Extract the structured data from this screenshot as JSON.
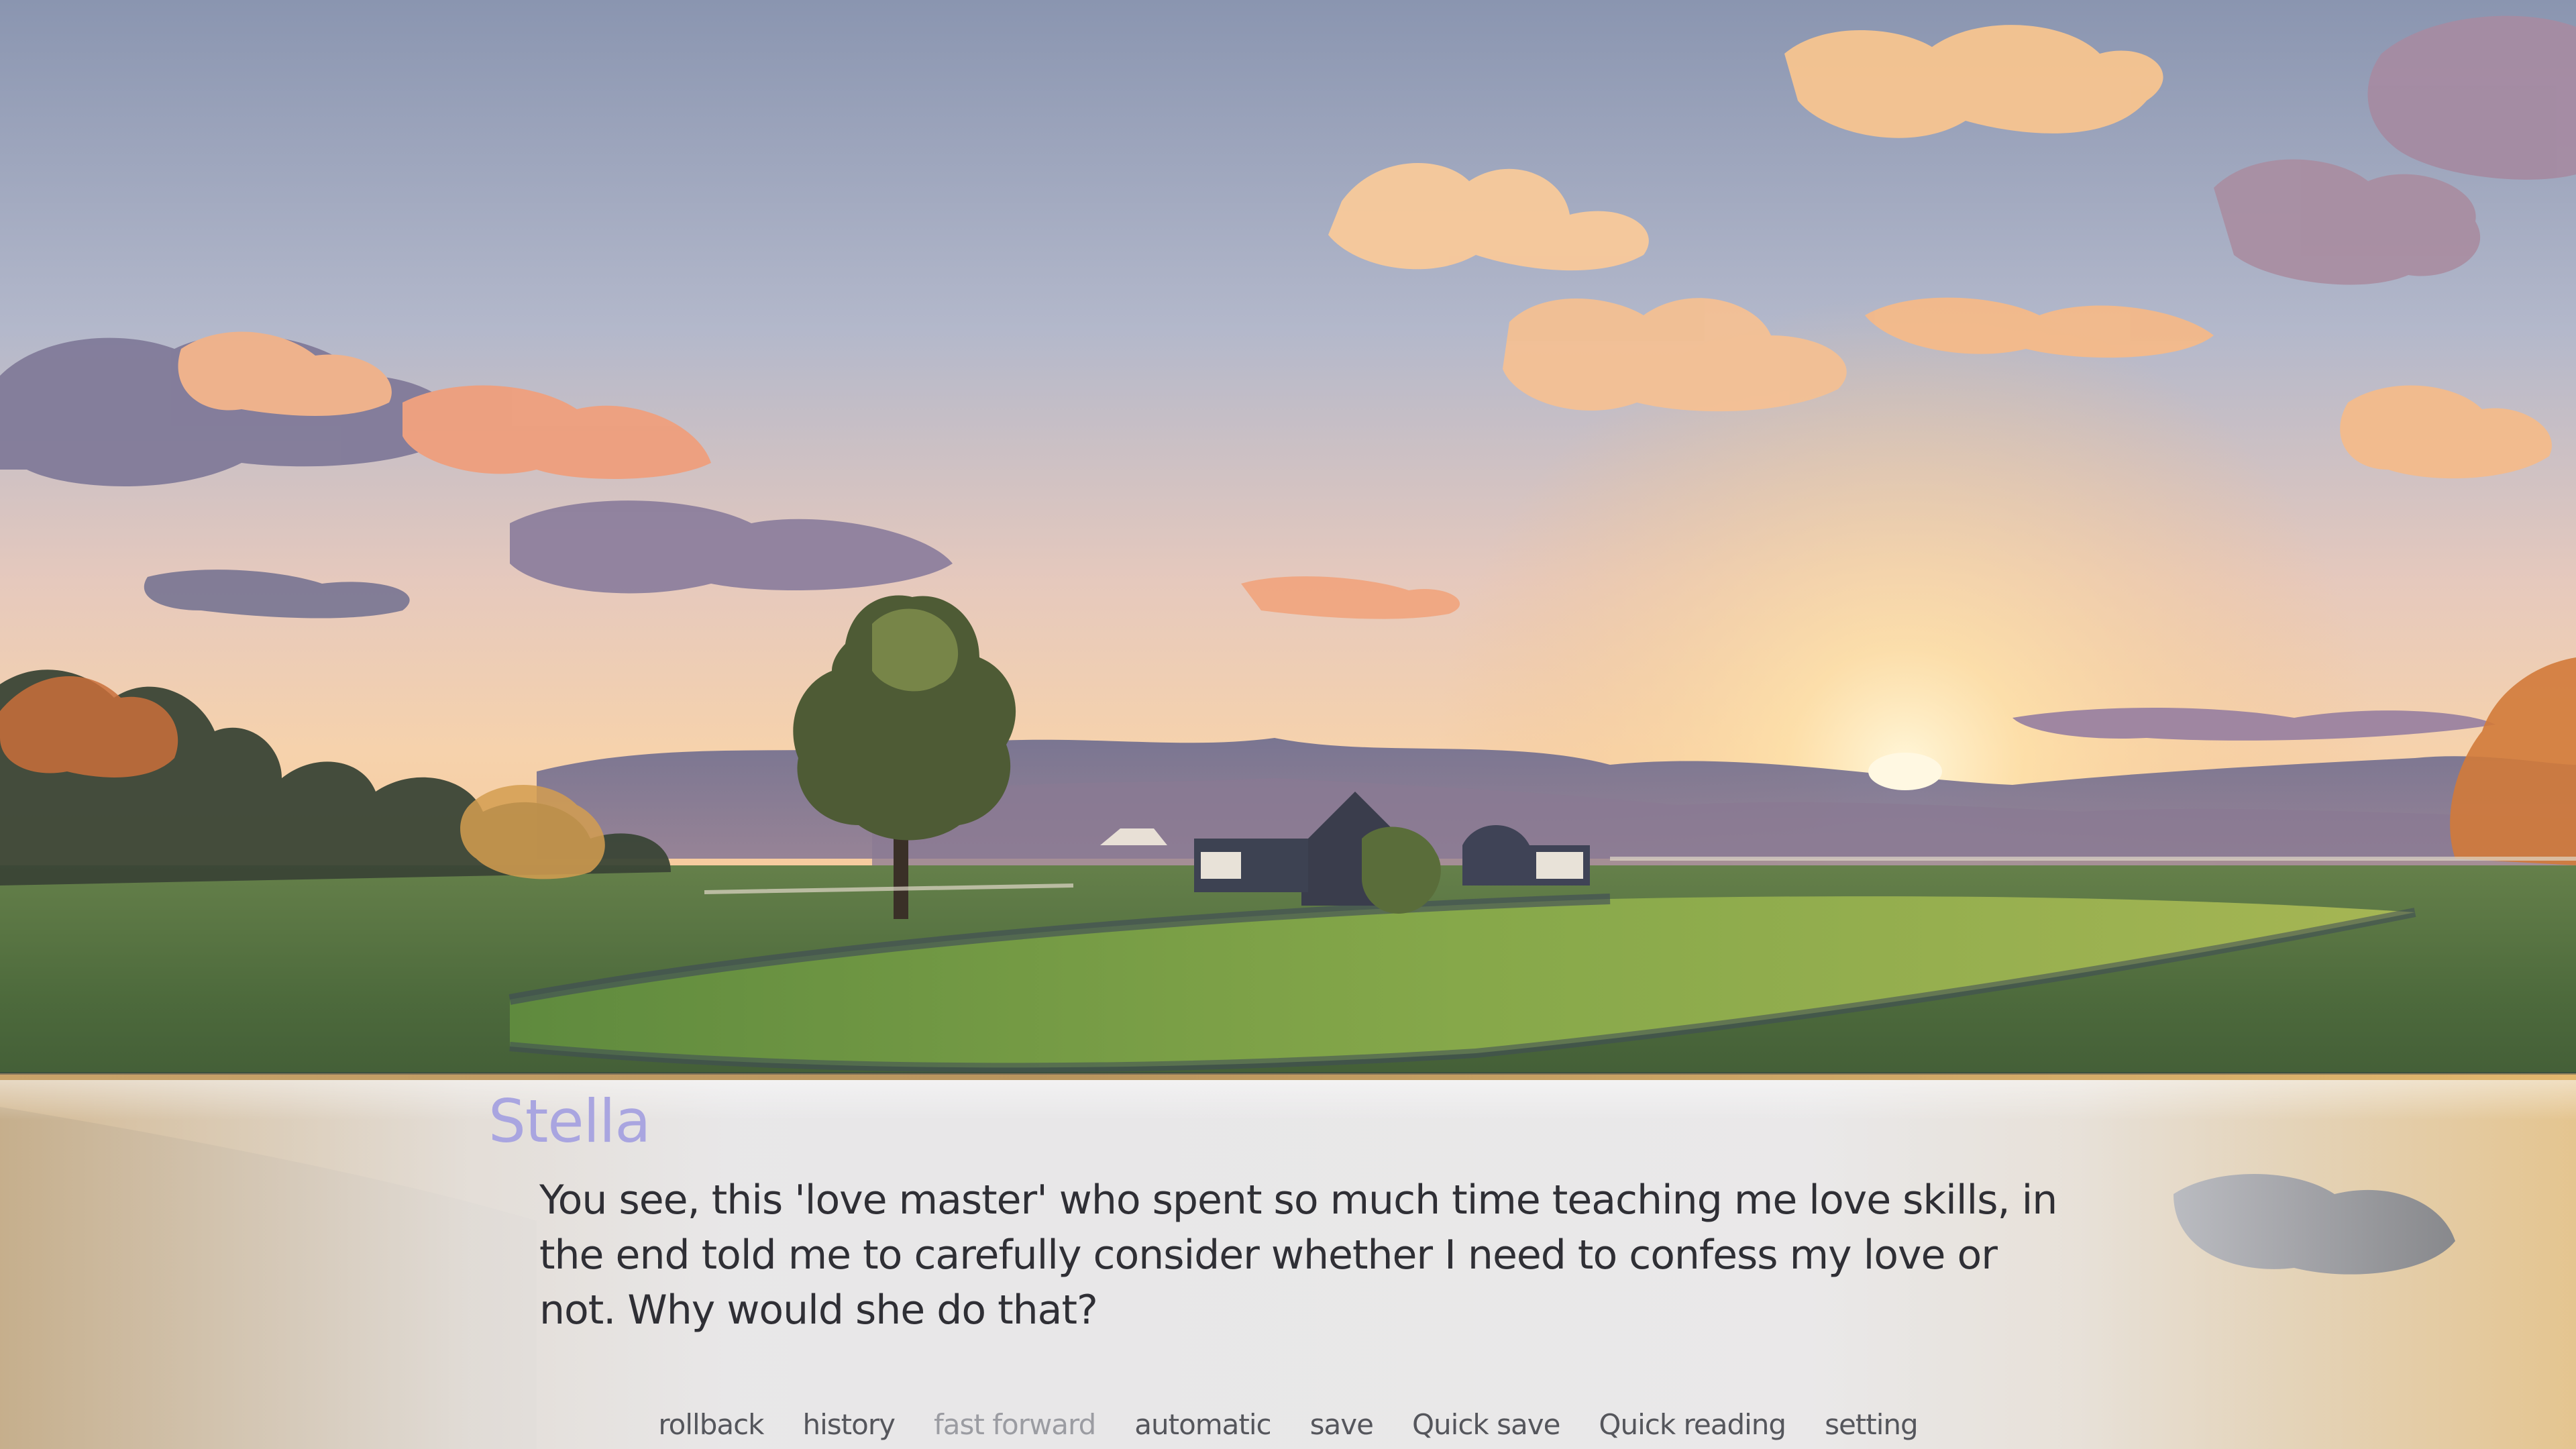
{
  "dialogue": {
    "speaker": "Stella",
    "text": "You see, this 'love master' who spent so much time teaching me love skills, in the end told me to carefully consider whether I need to confess my love or not. Why would she do that?"
  },
  "quick_menu": {
    "items": [
      {
        "label": "rollback",
        "enabled": true
      },
      {
        "label": "history",
        "enabled": true
      },
      {
        "label": "fast forward",
        "enabled": false
      },
      {
        "label": "automatic",
        "enabled": true
      },
      {
        "label": "save",
        "enabled": true
      },
      {
        "label": "Quick save",
        "enabled": true
      },
      {
        "label": "Quick reading",
        "enabled": true
      },
      {
        "label": "setting",
        "enabled": true
      }
    ]
  },
  "colors": {
    "speaker_name": "#a9a5e0",
    "dialogue_text": "#2f2f35",
    "menu_enabled": "#55565c",
    "menu_disabled": "#9b9ca2"
  }
}
